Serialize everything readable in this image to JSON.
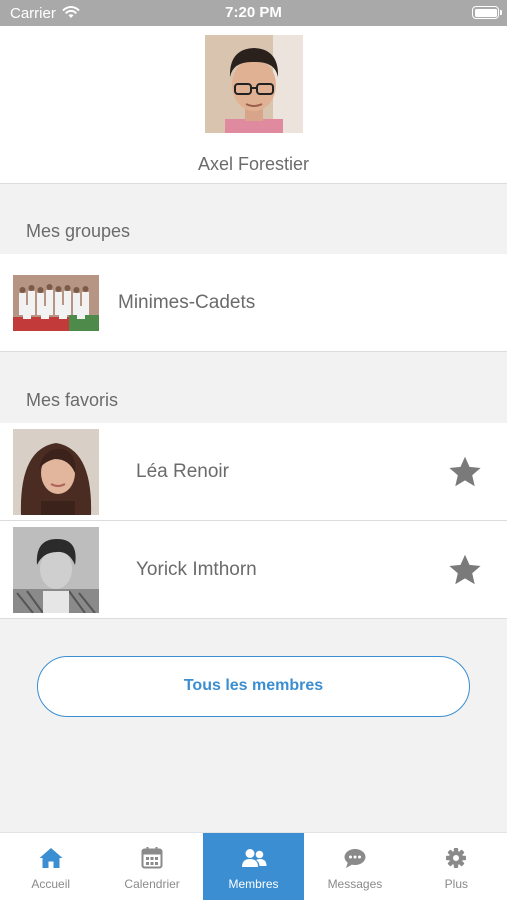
{
  "status_bar": {
    "carrier": "Carrier",
    "time": "7:20 PM"
  },
  "profile": {
    "name": "Axel Forestier"
  },
  "groups": {
    "title": "Mes groupes",
    "items": [
      {
        "label": "Minimes-Cadets"
      }
    ]
  },
  "favorites": {
    "title": "Mes favoris",
    "items": [
      {
        "label": "Léa Renoir"
      },
      {
        "label": "Yorick Imthorn"
      }
    ]
  },
  "all_members_button": "Tous les membres",
  "tabs": [
    {
      "label": "Accueil",
      "icon": "home-icon"
    },
    {
      "label": "Calendrier",
      "icon": "calendar-icon"
    },
    {
      "label": "Membres",
      "icon": "users-icon",
      "active": true
    },
    {
      "label": "Messages",
      "icon": "chat-icon"
    },
    {
      "label": "Plus",
      "icon": "gear-icon"
    }
  ],
  "colors": {
    "accent": "#3b8ed1",
    "status_bar": "#a9a9a9",
    "star": "#7a7a7a"
  }
}
